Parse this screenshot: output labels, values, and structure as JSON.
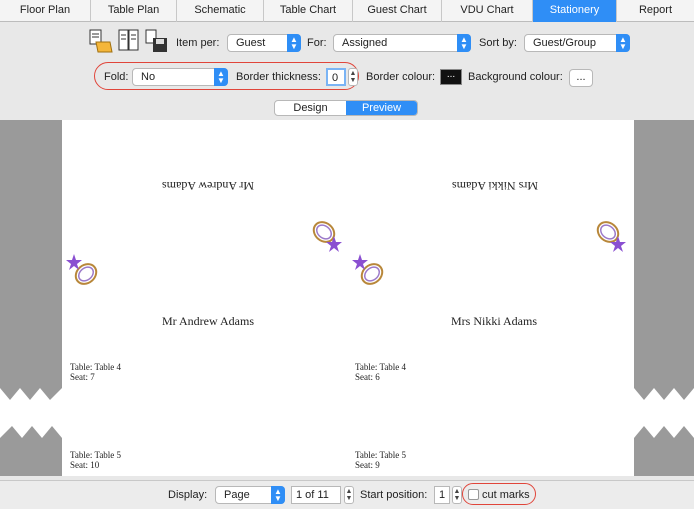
{
  "tabs": [
    {
      "label": "Floor Plan",
      "active": false
    },
    {
      "label": "Table Plan",
      "active": false
    },
    {
      "label": "Schematic",
      "active": false
    },
    {
      "label": "Table Chart",
      "active": false
    },
    {
      "label": "Guest Chart",
      "active": false
    },
    {
      "label": "VDU Chart",
      "active": false
    },
    {
      "label": "Stationery",
      "active": true
    },
    {
      "label": "Report",
      "active": false
    }
  ],
  "toolbar": {
    "item_per_label": "Item per:",
    "item_per_value": "Guest",
    "for_label": "For:",
    "for_value": "Assigned",
    "sort_by_label": "Sort by:",
    "sort_by_value": "Guest/Group",
    "fold_label": "Fold:",
    "fold_value": "No",
    "border_thickness_label": "Border thickness:",
    "border_thickness_value": "0",
    "border_colour_label": "Border colour:",
    "border_colour_button": "...",
    "background_colour_label": "Background colour:",
    "background_colour_button": "..."
  },
  "view_modes": {
    "design": "Design",
    "preview": "Preview",
    "active": "Preview"
  },
  "cards": [
    {
      "name": "Mr Andrew Adams",
      "inverted_name": "Mr Andrew Adams",
      "table": "Table: Table 4",
      "seat": "Seat: 7"
    },
    {
      "name": "Mrs Nikki Adams",
      "inverted_name": "Mrs Nikki Adams",
      "table": "Table: Table 4",
      "seat": "Seat: 6"
    },
    {
      "table": "Table: Table 5",
      "seat": "Seat: 10"
    },
    {
      "table": "Table: Table 5",
      "seat": "Seat: 9"
    }
  ],
  "bottom": {
    "display_label": "Display:",
    "display_value": "Page",
    "page_value": "1 of 11",
    "start_position_label": "Start position:",
    "start_position_value": "1",
    "cut_marks_label": "cut marks"
  },
  "colors": {
    "accent": "#2f8ef6",
    "highlight": "#e0453a",
    "border_colour_swatch": "#111111"
  }
}
